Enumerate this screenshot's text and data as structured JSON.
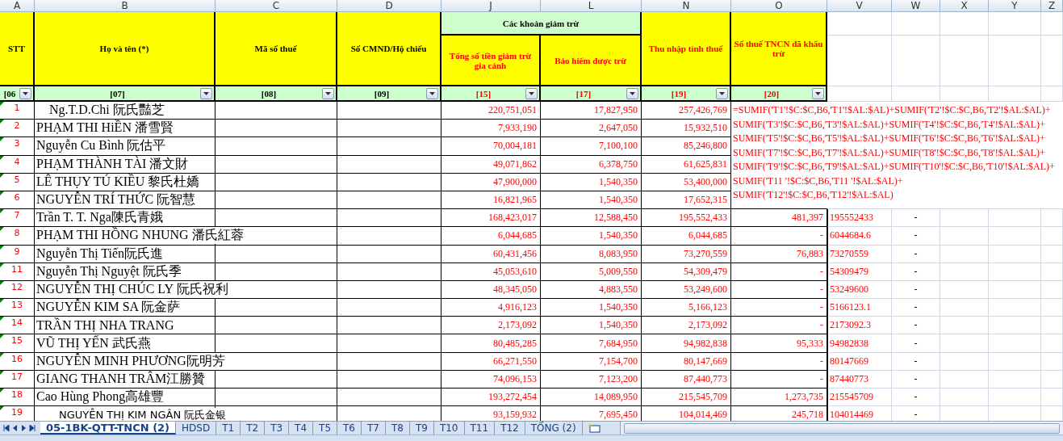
{
  "columns": [
    "A",
    "B",
    "C",
    "D",
    "J",
    "L",
    "N",
    "O",
    "V",
    "W",
    "X",
    "Y",
    "Z"
  ],
  "header": {
    "stt": {
      "label": "STT",
      "color": "#000000"
    },
    "name": {
      "label": "Họ và tên (*)",
      "color": "#000000"
    },
    "tax_code": {
      "label": "Mã số thuế",
      "color": "#000000"
    },
    "id_card": {
      "label": "Số CMND/Hộ chiếu",
      "color": "#000000"
    },
    "deductions_group": {
      "label": "Các khoản giảm trừ",
      "color": "#000000"
    },
    "deduction_total": {
      "label": "Tổng số tiền  giảm trừ gia cảnh",
      "color": "#ff0000"
    },
    "insurance": {
      "label": "Bảo hiểm được trừ",
      "color": "#ff0000"
    },
    "taxable_income": {
      "label": "Thu nhập tính thuế",
      "color": "#ff0000"
    },
    "tax_withheld": {
      "label": "Số thuế TNCN đã khấu trừ",
      "color": "#ff0000"
    }
  },
  "filter_row": [
    {
      "code": "[06",
      "color": "#000000"
    },
    {
      "code": "[07]",
      "color": "#000000"
    },
    {
      "code": "[08]",
      "color": "#000000"
    },
    {
      "code": "[09]",
      "color": "#000000"
    },
    {
      "code": "[15]",
      "color": "#ff0000"
    },
    {
      "code": "[17]",
      "color": "#ff0000"
    },
    {
      "code": "[19]",
      "color": "#ff0000"
    },
    {
      "code": "[20]",
      "color": "#ff0000"
    }
  ],
  "rows": [
    {
      "stt": "1",
      "kind": "indented",
      "name": "Ng.T.D.Chi  阮氏豔芝",
      "deduction_total": "220,751,051",
      "insurance": "17,827,950",
      "taxable_income": "257,426,769"
    },
    {
      "stt": "2",
      "kind": "normal",
      "name": "PHẠM THI HiỀN 潘雪賢",
      "deduction_total": "7,933,190",
      "insurance": "2,647,050",
      "taxable_income": "15,932,510"
    },
    {
      "stt": "3",
      "kind": "normal",
      "name": "Nguyễn Cu Bình  阮估平",
      "deduction_total": "70,004,181",
      "insurance": "7,100,100",
      "taxable_income": "85,246,800"
    },
    {
      "stt": "4",
      "kind": "normal",
      "name": "PHẠM THÀNH TÀI 潘文財",
      "deduction_total": "49,071,862",
      "insurance": "6,378,750",
      "taxable_income": "61,625,831"
    },
    {
      "stt": "5",
      "kind": "normal",
      "name": "LÊ THỤY TÚ KIỀU 黎氏杜嬌",
      "deduction_total": "47,900,000",
      "insurance": "1,540,350",
      "taxable_income": "53,400,000"
    },
    {
      "stt": "6",
      "kind": "normal",
      "name": "NGUYỄN TRÍ THỨC  阮智慧",
      "deduction_total": "16,821,965",
      "insurance": "1,540,350",
      "taxable_income": "17,652,315"
    },
    {
      "stt": "7",
      "kind": "normal",
      "name": "Trần T. T. Nga陳氏青娥",
      "deduction_total": "168,423,017",
      "insurance": "12,588,450",
      "taxable_income": "195,552,433",
      "tax_withheld": "481,397",
      "column_v": "195552433",
      "column_w": "-"
    },
    {
      "stt": "8",
      "kind": "normal",
      "name": "PHẠM THI HỒNG NHUNG 潘氏紅蓉",
      "deduction_total": "6,044,685",
      "insurance": "1,540,350",
      "taxable_income": "6,044,685",
      "tax_withheld": "-",
      "column_v": "6044684.6",
      "column_w": "-"
    },
    {
      "stt": "9",
      "kind": "normal",
      "name": "Nguyễn Thị Tiến阮氏進",
      "deduction_total": "60,431,456",
      "insurance": "8,083,950",
      "taxable_income": "73,270,559",
      "tax_withheld": "76,883",
      "column_v": "73270559",
      "column_w": "-"
    },
    {
      "stt": "11",
      "kind": "normal",
      "name": "Nguyễn Thị Nguyệt  阮氏季",
      "deduction_total": "45,053,610",
      "insurance": "5,009,550",
      "taxable_income": "54,309,479",
      "tax_withheld": "-",
      "column_v": "54309479",
      "column_w": "-"
    },
    {
      "stt": "12",
      "kind": "normal",
      "name": "NGUYỄN THỊ CHÚC LY 阮氏祝利",
      "deduction_total": "48,345,050",
      "insurance": "4,883,550",
      "taxable_income": "53,249,600",
      "tax_withheld": "-",
      "column_v": "53249600",
      "column_w": "-"
    },
    {
      "stt": "13",
      "kind": "normal",
      "name": "NGUYỄN KIM SA 阮金萨",
      "deduction_total": "4,916,123",
      "insurance": "1,540,350",
      "taxable_income": "5,166,123",
      "tax_withheld": "-",
      "column_v": "5166123.1",
      "column_w": "-"
    },
    {
      "stt": "14",
      "kind": "normal",
      "name": "TRẦN THỊ NHA TRANG",
      "deduction_total": "2,173,092",
      "insurance": "1,540,350",
      "taxable_income": "2,173,092",
      "tax_withheld": "-",
      "column_v": "2173092.3",
      "column_w": "-"
    },
    {
      "stt": "15",
      "kind": "normal",
      "name": "VŨ THỊ YẾN 武氏燕",
      "deduction_total": "80,485,285",
      "insurance": "7,684,950",
      "taxable_income": "94,982,838",
      "tax_withheld": "95,333",
      "column_v": "94982838",
      "column_w": "-"
    },
    {
      "stt": "16",
      "kind": "normal",
      "name": "NGUYỄN MINH PHƯƠNG阮明芳",
      "deduction_total": "66,271,550",
      "insurance": "7,154,700",
      "taxable_income": "80,147,669",
      "tax_withheld": "-",
      "column_v": "80147669",
      "column_w": "-"
    },
    {
      "stt": "17",
      "kind": "normal",
      "name": "GIANG THANH TRÂM江勝贊",
      "deduction_total": "74,096,153",
      "insurance": "7,123,200",
      "taxable_income": "87,440,773",
      "tax_withheld": "-",
      "column_v": "87440773",
      "column_w": "-"
    },
    {
      "stt": "18",
      "kind": "normal",
      "name": "Cao Hùng Phong高雄豐",
      "deduction_total": "193,272,454",
      "insurance": "14,089,950",
      "taxable_income": "215,545,709",
      "tax_withheld": "1,273,735",
      "column_v": "215545709",
      "column_w": "-"
    },
    {
      "stt": "19",
      "kind": "indented_sans",
      "name": "NGUYỄN THỊ KIM NGÂN 阮氏金银",
      "deduction_total": "93,159,932",
      "insurance": "7,695,450",
      "taxable_income": "104,014,469",
      "tax_withheld": "245,718",
      "column_v": "104014469",
      "column_w": "-"
    }
  ],
  "formula_overlay": {
    "text": "=SUMIF('T1'!$C:$C,B6,'T1'!$AL:$AL)+SUMIF('T2'!$C:$C,B6,'T2'!$AL:$AL)+SUMIF('T3'!$C:$C,B6,'T3'!$AL:$AL)+SUMIF('T4'!$C:$C,B6,'T4'!$AL:$AL)+SUMIF('T5'!$C:$C,B6,'T5'!$AL:$AL)+SUMIF('T6'!$C:$C,B6,'T6'!$AL:$AL)+SUMIF('T7'!$C:$C,B6,'T7'!$AL:$AL)+SUMIF('T8'!$C:$C,B6,'T8'!$AL:$AL)+SUMIF('T9'!$C:$C,B6,'T9'!$AL:$AL)+SUMIF('T10'!$C:$C,B6,'T10'!$AL:$AL)+SUMIF('T11 '!$C:$C,B6,'T11 '!$AL:$AL)+SUMIF('T12'!$C:$C,B6,'T12'!$AL:$AL)"
  },
  "sheet_tabs": [
    {
      "label": "05-1BK-QTT-TNCN (2)",
      "selected": true
    },
    {
      "label": "HDSD",
      "selected": false
    },
    {
      "label": "T1",
      "selected": false
    },
    {
      "label": "T2",
      "selected": false
    },
    {
      "label": "T3",
      "selected": false
    },
    {
      "label": "T4",
      "selected": false
    },
    {
      "label": "T5",
      "selected": false
    },
    {
      "label": "T6",
      "selected": false
    },
    {
      "label": "T7",
      "selected": false
    },
    {
      "label": "T8",
      "selected": false
    },
    {
      "label": "T9",
      "selected": false
    },
    {
      "label": "T10",
      "selected": false
    },
    {
      "label": "T11",
      "selected": false
    },
    {
      "label": "T12",
      "selected": false
    },
    {
      "label": "TỔNG (2)",
      "selected": false
    }
  ]
}
